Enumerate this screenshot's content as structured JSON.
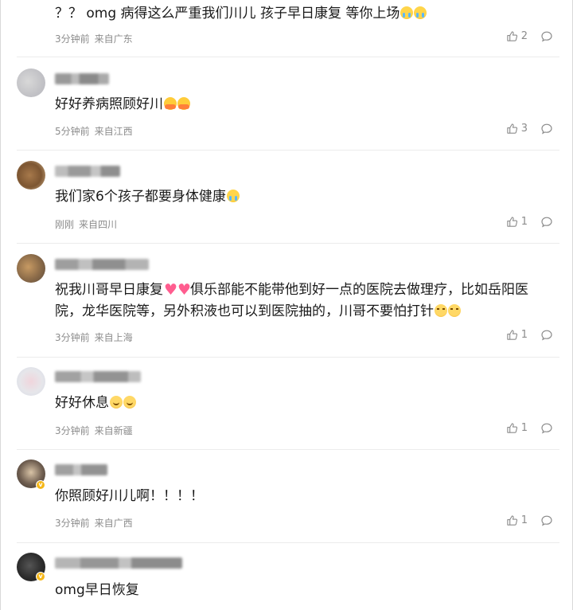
{
  "comments": [
    {
      "text": "？？ omg 病得这么严重我们川儿 孩子早日康复 等你上场",
      "emojis": [
        "e-cry",
        "e-cry"
      ],
      "time": "3分钟前",
      "location": "来自广东",
      "likes": "2"
    },
    {
      "text": "好好养病照顾好川",
      "emojis": [
        "e-hug",
        "e-hug"
      ],
      "time": "5分钟前",
      "location": "来自江西",
      "likes": "3"
    },
    {
      "text": "我们家6个孩子都要身体健康",
      "emojis": [
        "e-cry"
      ],
      "time": "刚刚",
      "location": "来自四川",
      "likes": "1"
    },
    {
      "text_a": "祝我川哥早日康复",
      "text_b": "俱乐部能不能带他到好一点的医院去做理疗，比如岳阳医院，龙华医院等，另外积液也可以到医院抽的，川哥不要怕打针",
      "emojis": [
        "e-heart",
        "e-heart",
        "e-blush",
        "e-blush"
      ],
      "time": "3分钟前",
      "location": "来自上海",
      "likes": "1"
    },
    {
      "text": "好好休息",
      "emojis": [
        "e-pray",
        "e-pray"
      ],
      "time": "3分钟前",
      "location": "来自新疆",
      "likes": "1"
    },
    {
      "text": "你照顾好川儿啊！！！！",
      "time": "3分钟前",
      "location": "来自广西",
      "likes": "1"
    },
    {
      "text": "omg早日恢复"
    }
  ],
  "colors": {
    "meta_text": "#8c8c8c",
    "divider": "#ececec",
    "verified_badge": "#f5b718"
  },
  "icons": {
    "like": "thumbs-up-icon",
    "reply": "comment-bubble-icon",
    "verified": "verified-v-icon"
  }
}
